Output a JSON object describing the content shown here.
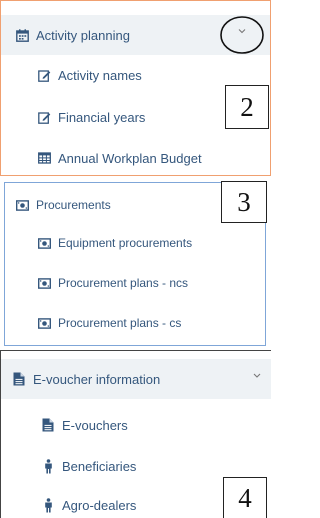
{
  "activity_planning": {
    "title": "Activity planning",
    "items": [
      "Activity names",
      "Financial years",
      "Annual Workplan Budget"
    ],
    "label_number": "2",
    "border_color": "#f0a070"
  },
  "procurements": {
    "title": "Procurements",
    "items": [
      "Equipment procurements",
      "Procurement plans - ncs",
      "Procurement plans - cs"
    ],
    "label_number": "3",
    "border_color": "#7fa6d8"
  },
  "evoucher": {
    "title": "E-voucher information",
    "items": [
      "E-vouchers",
      "Beneficiaries",
      "Agro-dealers"
    ],
    "label_number": "4"
  },
  "icons": {
    "activity_planning": "calendar-icon",
    "activity_item": "edit-icon",
    "budget_item": "table-icon",
    "procurement": "money-icon",
    "evoucher": "document-icon",
    "person": "person-icon",
    "chevron": "chevron-down-icon"
  },
  "colors": {
    "text": "#35577d",
    "header_bg": "#eef2f5"
  }
}
